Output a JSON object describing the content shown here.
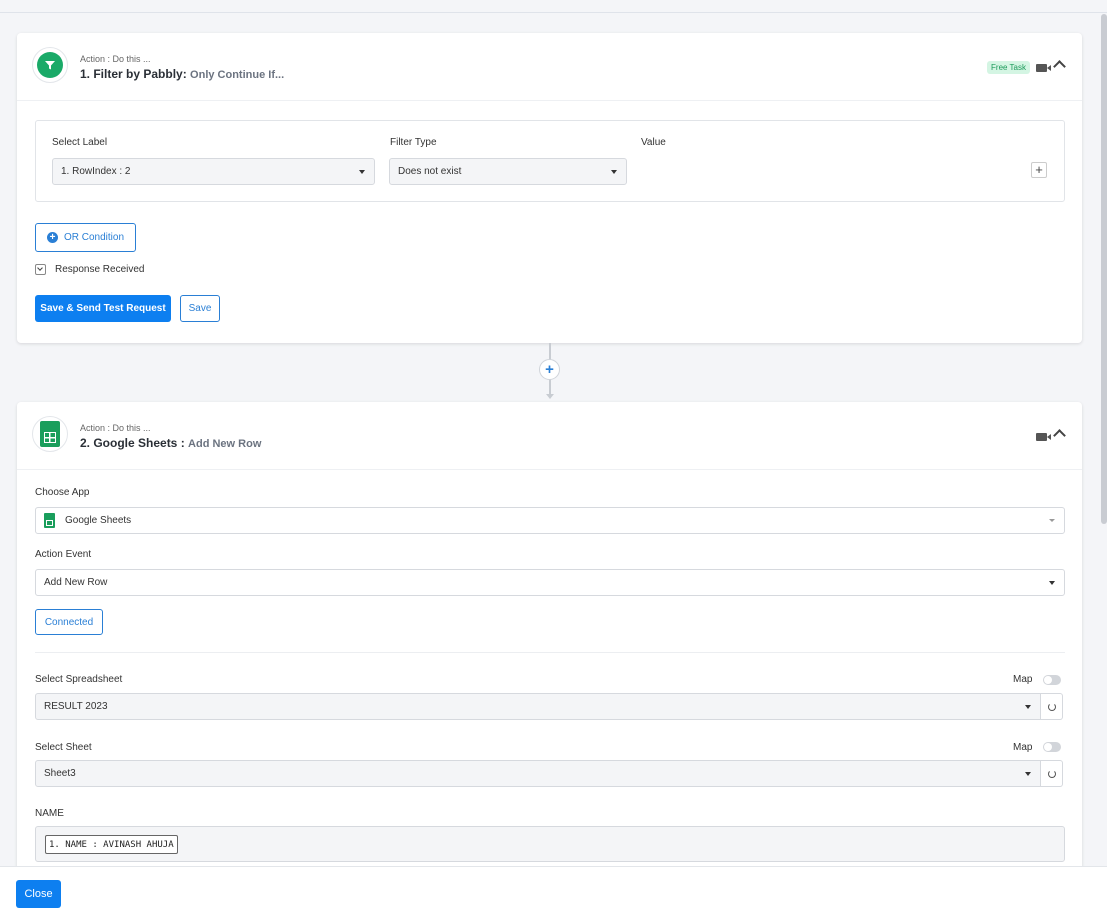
{
  "steps": [
    {
      "subtitle": "Action : Do this ...",
      "title": "1. Filter by Pabbly:",
      "description": "Only Continue If...",
      "badge": "Free Task",
      "icon": "filter-icon",
      "filter": {
        "select_label_label": "Select Label",
        "filter_type_label": "Filter Type",
        "value_label": "Value",
        "select_label_value": "1. RowIndex : 2",
        "filter_type_value": "Does not exist",
        "add_symbol": "+"
      },
      "or_condition_label": "OR Condition",
      "response_received_label": "Response Received",
      "save_send_label": "Save & Send Test Request",
      "save_label": "Save"
    },
    {
      "subtitle": "Action : Do this ...",
      "title": "2. Google Sheets :",
      "description": "Add New Row",
      "icon": "google-sheets-icon",
      "choose_app_label": "Choose App",
      "choose_app_value": "Google Sheets",
      "action_event_label": "Action Event",
      "action_event_value": "Add New Row",
      "connected_label": "Connected",
      "spreadsheet_label": "Select Spreadsheet",
      "spreadsheet_value": "RESULT 2023",
      "sheet_label": "Select Sheet",
      "sheet_value": "Sheet3",
      "map_label": "Map",
      "name_label": "NAME",
      "name_chip": "1. NAME : AVINASH AHUJA"
    }
  ],
  "connector": {
    "add_symbol": "+"
  },
  "footer": {
    "close_label": "Close"
  },
  "colors": {
    "primary": "#0d7ff0",
    "sheets_green": "#1a9e5c",
    "filter_green": "#1aaa68"
  }
}
